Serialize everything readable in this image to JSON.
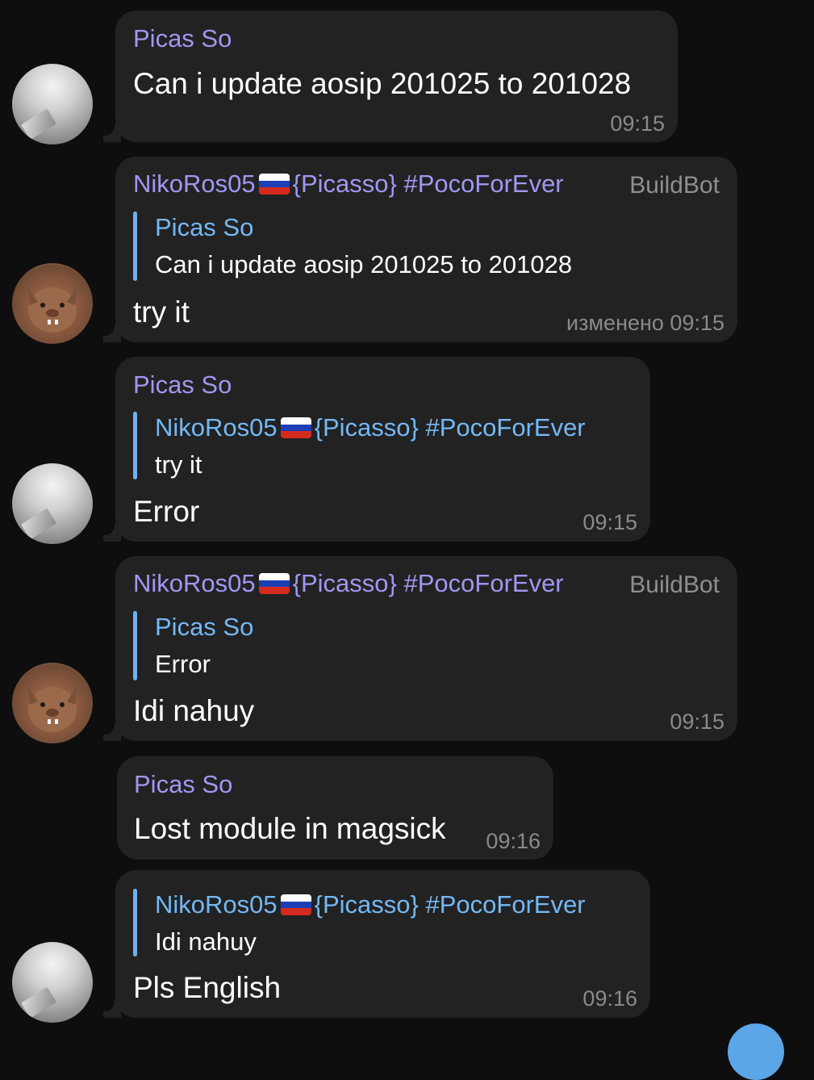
{
  "colors": {
    "background": "#0e0e0e",
    "bubble": "#222222",
    "sender_name": "#a097f2",
    "reply_name": "#74b8f5",
    "reply_bar": "#6ab3f3",
    "timestamp": "#8a8a8a"
  },
  "messages": [
    {
      "sender": "Picas So",
      "text": "Can i update aosip 201025 to 201028",
      "time": "09:15"
    },
    {
      "sender": "NikoRos05",
      "sender_suffix": "{Picasso} #PocoForEver",
      "badge": "BuildBot",
      "reply_name": "Picas So",
      "reply_text": "Can i update aosip 201025 to 201028",
      "text": "try it",
      "time": "изменено 09:15"
    },
    {
      "sender": "Picas So",
      "reply_name": "NikoRos05",
      "reply_suffix": "{Picasso} #PocoForEver",
      "reply_text": "try it",
      "text": "Error",
      "time": "09:15"
    },
    {
      "sender": "NikoRos05",
      "sender_suffix": "{Picasso} #PocoForEver",
      "badge": "BuildBot",
      "reply_name": "Picas So",
      "reply_text": "Error",
      "text": "Idi nahuy",
      "time": "09:15"
    },
    {
      "sender": "Picas So",
      "text": "Lost module in magsick",
      "time": "09:16"
    },
    {
      "reply_name": "NikoRos05",
      "reply_suffix": "{Picasso} #PocoForEver",
      "reply_text": "Idi nahuy",
      "text": "Pls English",
      "time": "09:16"
    }
  ]
}
